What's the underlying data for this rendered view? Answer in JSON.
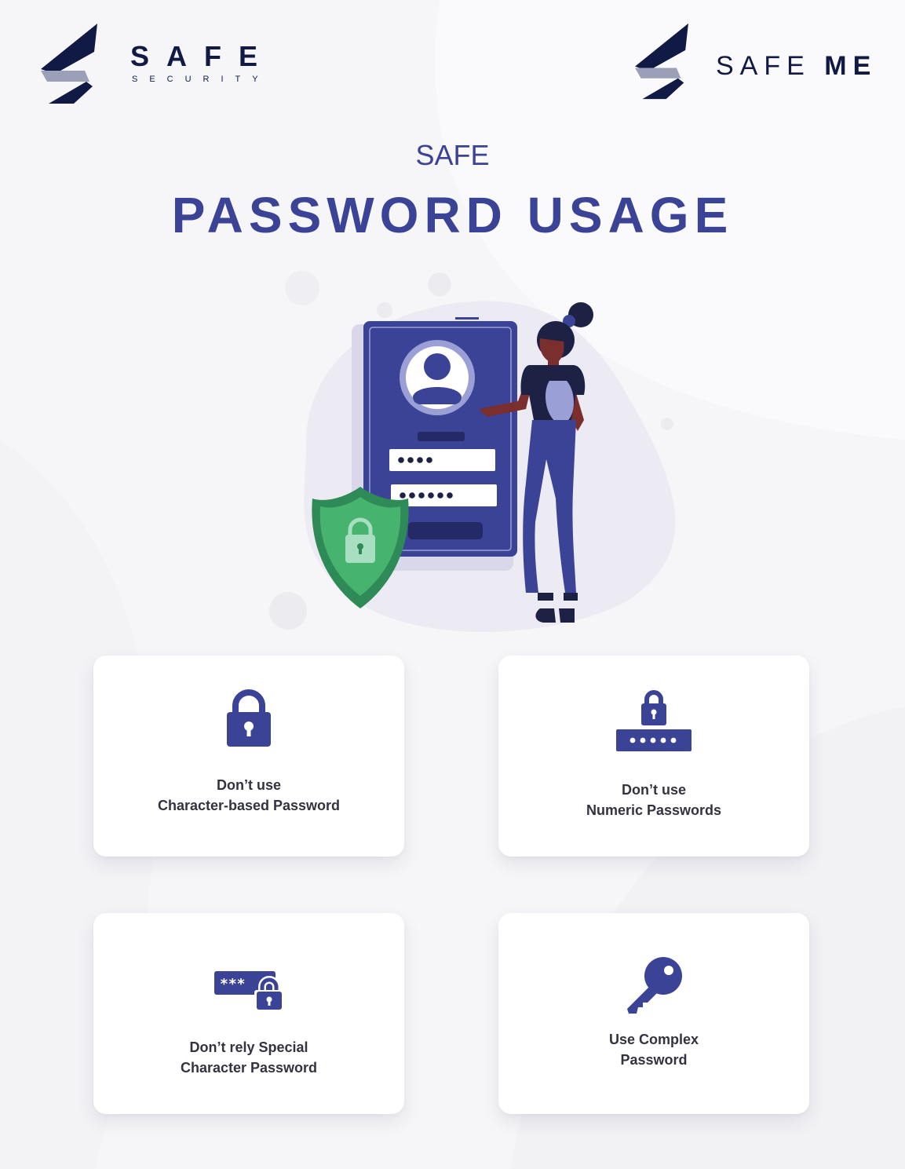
{
  "brand_left": {
    "name": "SAFE",
    "tagline": "SECURITY"
  },
  "brand_right": {
    "name_light": "SAFE",
    "name_bold": "ME"
  },
  "header": {
    "kicker": "SAFE",
    "title": "PASSWORD USAGE"
  },
  "colors": {
    "accent": "#3b4396",
    "navy": "#101a44",
    "shield_green": "#2e8b57",
    "text": "#333340"
  },
  "cards": [
    {
      "icon": "padlock-icon",
      "line1": "Don’t use",
      "line2": "Character-based Password"
    },
    {
      "icon": "padlock-pin-icon",
      "line1": "Don’t use",
      "line2": "Numeric Passwords"
    },
    {
      "icon": "masked-password-lock-icon",
      "line1": "Don’t rely Special",
      "line2": "Character Password"
    },
    {
      "icon": "key-icon",
      "line1": "Use Complex",
      "line2": "Password"
    }
  ]
}
